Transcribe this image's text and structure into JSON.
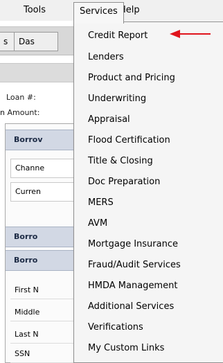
{
  "menubar": {
    "tools": "Tools",
    "services": "Services",
    "help": "Help"
  },
  "background": {
    "tabs": [
      "s",
      "Das"
    ],
    "loan_label": "Loan #: ",
    "amount_label": "n Amount:",
    "sections": [
      "Borrov",
      "Borro",
      "Borro"
    ],
    "fields": [
      "Channe",
      "Curren"
    ],
    "rows": [
      "First N",
      "Middle",
      "Last N",
      "SSN"
    ]
  },
  "services_menu": {
    "items": [
      "Credit Report",
      "Lenders",
      "Product and Pricing",
      "Underwriting",
      "Appraisal",
      "Flood Certification",
      "Title & Closing",
      "Doc Preparation",
      "MERS",
      "AVM",
      "Mortgage Insurance",
      "Fraud/Audit Services",
      "HMDA Management",
      "Additional Services",
      "Verifications",
      "My Custom Links"
    ]
  },
  "annotation": {
    "arrow_color": "#e0141c",
    "points_to": "Credit Report",
    "icon": "red-arrow-left-icon"
  }
}
